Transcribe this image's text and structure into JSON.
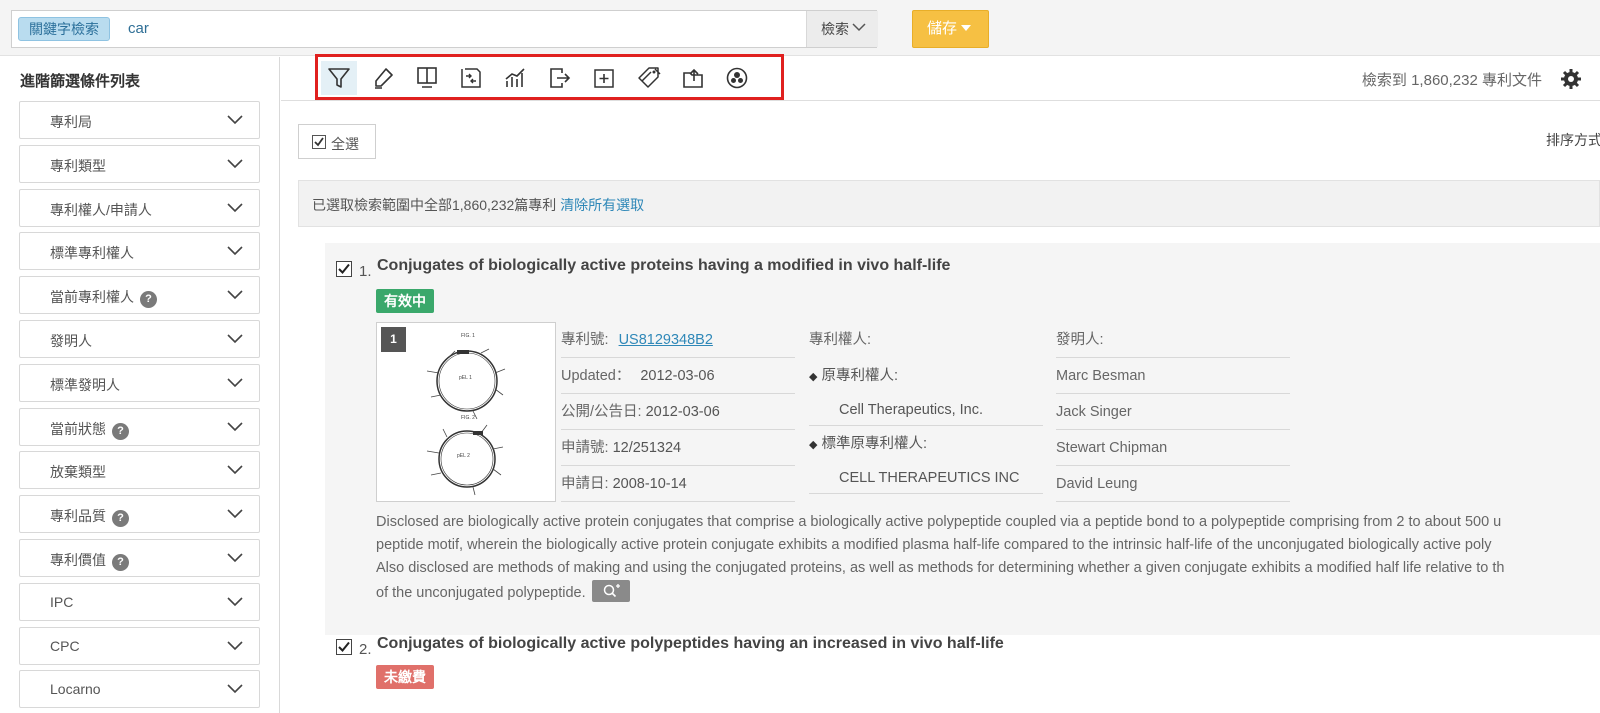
{
  "search": {
    "tag": "關鍵字檢索",
    "query": "car",
    "scope_label": "檢索",
    "save_label": "儲存"
  },
  "sidebar": {
    "title": "進階篩選條件列表",
    "items": [
      {
        "label": "專利局",
        "help": false
      },
      {
        "label": "專利類型",
        "help": false
      },
      {
        "label": "專利權人/申請人",
        "help": false
      },
      {
        "label": "標準專利權人",
        "help": false
      },
      {
        "label": "當前專利權人",
        "help": true
      },
      {
        "label": "發明人",
        "help": false
      },
      {
        "label": "標準發明人",
        "help": false
      },
      {
        "label": "當前狀態",
        "help": true
      },
      {
        "label": "放棄類型",
        "help": false
      },
      {
        "label": "專利品質",
        "help": true
      },
      {
        "label": "專利價值",
        "help": true
      },
      {
        "label": "IPC",
        "help": false
      },
      {
        "label": "CPC",
        "help": false
      },
      {
        "label": "Locarno",
        "help": false
      }
    ]
  },
  "toolbar": {
    "tools": [
      "filter-icon",
      "highlighter-icon",
      "monitor-icon",
      "compare-icon",
      "bar-chart-icon",
      "export-icon",
      "add-icon",
      "tag-icon",
      "folder-export-icon",
      "cluster-icon"
    ],
    "result_count": "檢索到 1,860,232 專利文件"
  },
  "select_all_label": "全選",
  "sort_label": "排序方式",
  "selection_banner": {
    "text": "已選取檢索範圍中全部1,860,232篇專利",
    "clear_link": "清除所有選取"
  },
  "results": [
    {
      "number": "1.",
      "title": "Conjugates of biologically active proteins having a modified in vivo half-life",
      "status": "有效中",
      "status_color": "#3aa86b",
      "thumb_index": "1",
      "patent_no_label": "專利號:",
      "patent_no": "US8129348B2",
      "updated_label": "Updated：",
      "updated": "2012-03-06",
      "pub_label": "公開/公告日:",
      "pub_date": "2012-03-06",
      "app_no_label": "申請號:",
      "app_no": "12/251324",
      "app_date_label": "申請日:",
      "app_date": "2008-10-14",
      "owner_label": "專利權人:",
      "orig_owner_label": "原專利權人:",
      "orig_owner": "Cell Therapeutics, Inc.",
      "std_owner_label": "標準原專利權人:",
      "std_owner": "CELL THERAPEUTICS INC",
      "inventor_label": "發明人:",
      "inventors": [
        "Marc Besman",
        "Jack Singer",
        "Stewart Chipman",
        "David Leung"
      ],
      "abstract": [
        "Disclosed are biologically active protein conjugates that comprise a biologically active polypeptide coupled via a peptide bond to a polypeptide comprising from 2 to about 500 u",
        "peptide motif, wherein the biologically active protein conjugate exhibits a modified plasma half-life compared to the intrinsic half-life of the unconjugated biologically active poly",
        "Also disclosed are methods of making and using the conjugated proteins, as well as methods for determining whether a given conjugate exhibits a modified half life relative to th",
        "of the unconjugated polypeptide."
      ]
    },
    {
      "number": "2.",
      "title": "Conjugates of biologically active polypeptides having an increased in vivo half-life",
      "status": "未繳費",
      "status_color": "#e0706a"
    }
  ],
  "colors": {
    "accent_blue": "#2f88b8",
    "save_button": "#f6c043",
    "highlight_frame": "#e0201f"
  }
}
